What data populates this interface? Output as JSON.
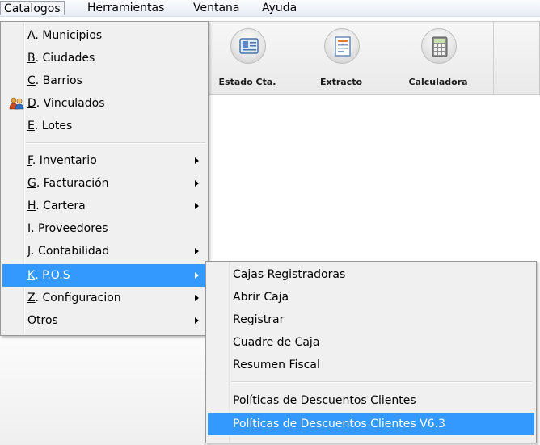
{
  "menubar": {
    "items": [
      {
        "label": "Catalogos"
      },
      {
        "label": "Herramientas"
      },
      {
        "label": "Ventana"
      },
      {
        "label": "Ayuda"
      }
    ]
  },
  "toolbar": {
    "buttons": [
      {
        "label": "Estado Cta.",
        "icon": "id-card-icon"
      },
      {
        "label": "Extracto",
        "icon": "document-icon"
      },
      {
        "label": "Calculadora",
        "icon": "calculator-icon"
      }
    ]
  },
  "catalogos_menu": {
    "items": [
      {
        "key": "A",
        "rest": ". Municipios"
      },
      {
        "key": "B",
        "rest": ". Ciudades"
      },
      {
        "key": "C",
        "rest": ". Barrios"
      },
      {
        "key": "D",
        "rest": ". Vinculados",
        "icon": "people-icon"
      },
      {
        "key": "E",
        "rest": ". Lotes"
      },
      {
        "key": "F",
        "rest": ".  Inventario",
        "submenu": true
      },
      {
        "key": "G",
        "rest": ". Facturación",
        "submenu": true
      },
      {
        "key": "H",
        "rest": ". Cartera",
        "submenu": true
      },
      {
        "key": "I",
        "rest": ".  Proveedores"
      },
      {
        "key": "J",
        "rest": ". Contabilidad",
        "submenu": true
      },
      {
        "key": "K",
        "rest": ". P.O.S",
        "submenu": true,
        "highlighted": true
      },
      {
        "key": "Z",
        "rest": ". Configuracion",
        "submenu": true
      },
      {
        "key": "O",
        "rest": "tros",
        "submenu": true
      }
    ]
  },
  "pos_submenu": {
    "items": [
      {
        "label": "Cajas Registradoras"
      },
      {
        "label": "Abrir Caja"
      },
      {
        "label": "Registrar"
      },
      {
        "label": "Cuadre de Caja"
      },
      {
        "label": "Resumen Fiscal"
      },
      {
        "label": "Políticas de Descuentos Clientes"
      },
      {
        "label": "Políticas de Descuentos Clientes V6.3",
        "highlighted": true
      }
    ]
  },
  "colors": {
    "highlight": "#3399ff",
    "menu_bg": "#f0f0f0"
  }
}
